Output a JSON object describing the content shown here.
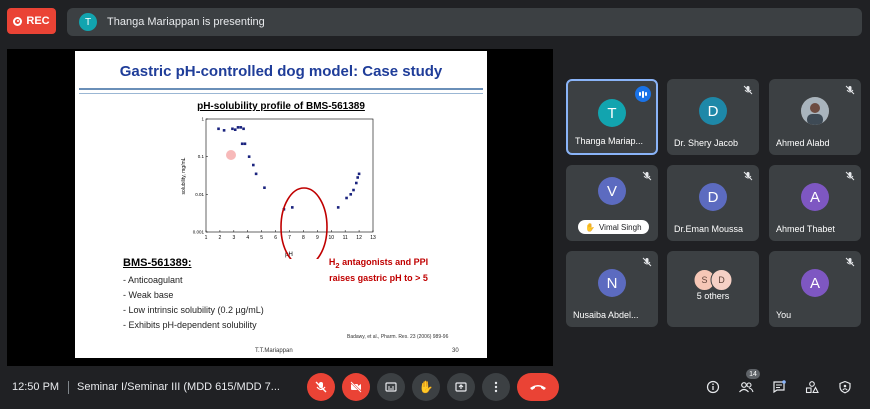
{
  "recording": {
    "label": "REC",
    "color": "#ea4335"
  },
  "presenter_bar": {
    "avatar_letter": "T",
    "text": "Thanga Mariappan is presenting"
  },
  "slide": {
    "title": "Gastric pH-controlled dog model: Case study",
    "subtitle": "pH-solubility profile of BMS-561389",
    "compound_heading": "BMS-561389:",
    "bullets": [
      "Anticoagulant",
      "Weak base",
      "Low intrinsic solubility (0.2 µg/mL)",
      "Exhibits pH-dependent solubility"
    ],
    "annotation_line1": "H",
    "annotation_sub": "2",
    "annotation_line1_rest": " antagonists and PPI",
    "annotation_line2": "raises gastric pH to > 5",
    "citation": "Badawy, et al., Pharm. Res. 23 (2006) 989-96",
    "footer": "T.T.Mariappan",
    "page_number": "30",
    "chart": {
      "ylabel": "solubility, mg/mL",
      "xlabel": "pH",
      "x_ticks": [
        "1",
        "2",
        "3",
        "4",
        "5",
        "6",
        "7",
        "8",
        "9",
        "10",
        "11",
        "12",
        "13"
      ],
      "y_ticks": [
        "1",
        "0.1",
        "0.01",
        "0.001"
      ]
    }
  },
  "participants": [
    {
      "name": "Thanga Mariap...",
      "letter": "T",
      "color": "#12a4af",
      "speaking": true
    },
    {
      "name": "Dr. Shery Jacob",
      "letter": "D",
      "color": "#1e88a8",
      "muted": true
    },
    {
      "name": "Ahmed Alabd",
      "letter": "",
      "color": "#7c6b5a",
      "muted": true
    },
    {
      "name": "Vimal Singh",
      "letter": "V",
      "color": "#5c6bc0",
      "muted": true,
      "hand_raised": true
    },
    {
      "name": "Dr.Eman Moussa",
      "letter": "D",
      "color": "#5c6bc0",
      "muted": true
    },
    {
      "name": "Ahmed Thabet",
      "letter": "A",
      "color": "#7e57c2",
      "muted": true
    },
    {
      "name": "Nusaiba Abdel...",
      "letter": "N",
      "color": "#5c6bc0",
      "muted": true
    },
    {
      "name": "5 others",
      "letter": "",
      "others": [
        "S",
        "D"
      ]
    },
    {
      "name": "You",
      "letter": "A",
      "color": "#7e57c2",
      "muted": true
    }
  ],
  "bottom_bar": {
    "time": "12:50 PM",
    "meeting_name": "Seminar I/Seminar III (MDD 615/MDD 7...",
    "people_count": "14"
  },
  "chart_data": {
    "type": "scatter",
    "xlabel": "pH",
    "ylabel": "solubility, mg/mL",
    "xlim": [
      1,
      13
    ],
    "ylim": [
      0.001,
      1
    ],
    "yscale": "log",
    "series": [
      {
        "x": [
          1.9,
          2.3,
          2.9,
          3.1,
          3.3,
          3.5,
          3.7,
          3.6,
          3.8,
          4.1,
          4.4,
          4.6,
          5.2,
          6.6,
          7.2,
          10.5,
          11.1,
          11.4,
          11.6,
          11.8,
          11.9,
          12.0
        ],
        "y": [
          0.55,
          0.5,
          0.55,
          0.52,
          0.6,
          0.6,
          0.55,
          0.22,
          0.22,
          0.1,
          0.06,
          0.035,
          0.015,
          0.004,
          0.0045,
          0.0045,
          0.008,
          0.01,
          0.013,
          0.02,
          0.028,
          0.035
        ]
      }
    ]
  }
}
